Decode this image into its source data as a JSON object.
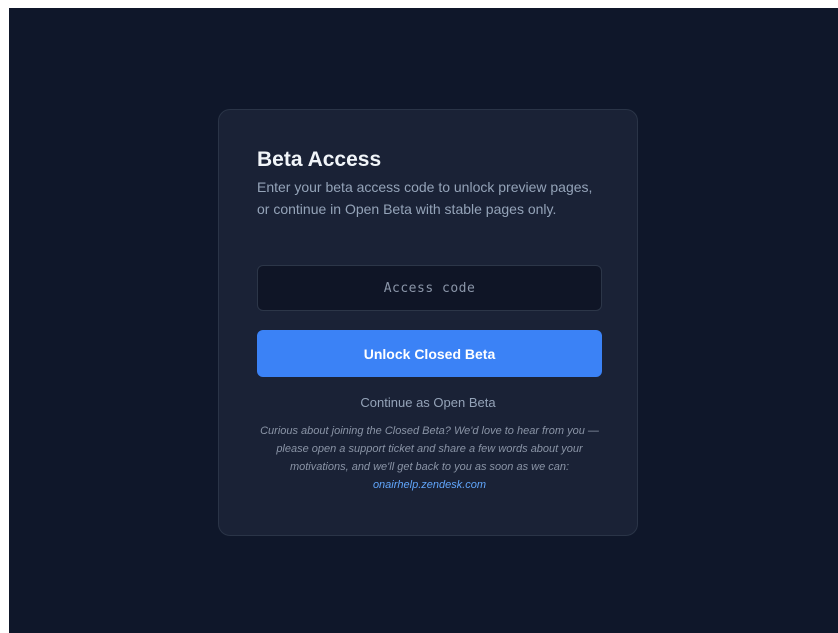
{
  "card": {
    "title": "Beta Access",
    "description": "Enter your beta access code to unlock preview pages, or continue in Open Beta with stable pages only.",
    "input": {
      "placeholder": "Access code",
      "value": ""
    },
    "unlock_label": "Unlock Closed Beta",
    "open_beta_label": "Continue as Open Beta",
    "note_text": "Curious about joining the Closed Beta? We'd love to hear from you — please open a support ticket and share a few words about your motivations, and we'll get back to you as soon as we can: ",
    "note_link": "onairhelp.zendesk.com"
  },
  "colors": {
    "background": "#0f172a",
    "card": "#1a2236",
    "accent": "#3b82f6",
    "link": "#60a5fa"
  }
}
